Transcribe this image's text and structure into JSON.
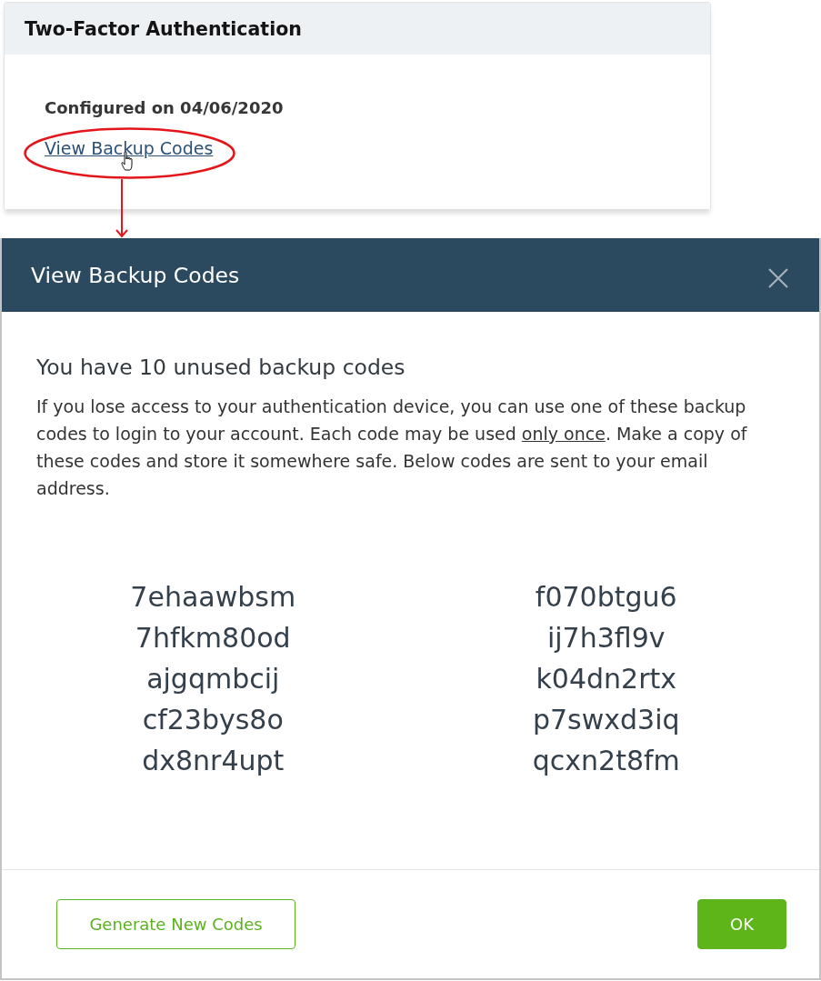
{
  "card": {
    "title": "Two-Factor Authentication",
    "status": "Configured on 04/06/2020",
    "link": "View Backup Codes"
  },
  "dialog": {
    "title": "View Backup Codes",
    "heading": "You have 10 unused backup codes",
    "message": {
      "before": "If you lose access to your authentication device, you can use one of these backup codes to login to your account. Each code may be used ",
      "link": "only once",
      "after": ". Make a copy of these codes and store it somewhere safe. Below codes are sent to your email address."
    },
    "code_columns": [
      [
        "7ehaawbsm",
        "7hfkm80od",
        "ajgqmbcij",
        "cf23bys8o",
        "dx8nr4upt"
      ],
      [
        "f070btgu6",
        "ij7h3fl9v",
        "k04dn2rtx",
        "p7swxd3iq",
        "qcxn2t8fm"
      ]
    ],
    "buttons": [
      {
        "label": "Generate New Codes",
        "kind": "secondary"
      },
      {
        "label": "OK",
        "kind": "primary"
      }
    ]
  }
}
